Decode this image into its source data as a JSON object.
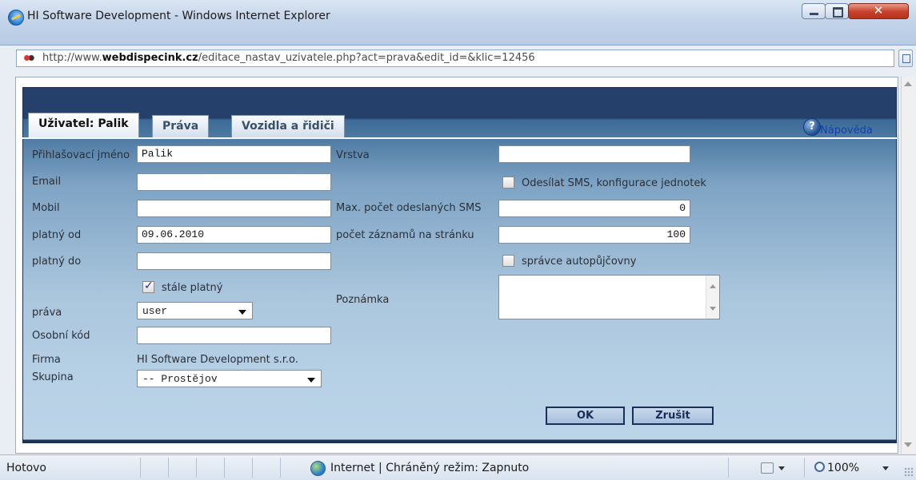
{
  "window": {
    "title": "HI Software Development - Windows Internet Explorer",
    "icon": "internet-explorer-icon"
  },
  "address": {
    "prefix": "http://www.",
    "domain": "webdispecink.cz",
    "path": "/editace_nastav_uzivatele.php?act=prava&edit_id=&klic=12456"
  },
  "tabs": [
    {
      "label": "Uživatel:  Palik",
      "active": true
    },
    {
      "label": "Práva",
      "active": false
    },
    {
      "label": "Vozidla a řidiči",
      "active": false
    }
  ],
  "help": {
    "label": "Nápověda",
    "icon": "help-icon"
  },
  "form": {
    "login_label": "Přihlašovací jméno",
    "login_value": "Palik",
    "email_label": "Email",
    "email_value": "",
    "mobile_label": "Mobil",
    "mobile_value": "",
    "valid_from_label": "platný od",
    "valid_from_value": "09.06.2010",
    "valid_to_label": "platný do",
    "valid_to_value": "",
    "always_valid_label": "stále platný",
    "always_valid_checked": true,
    "rights_label": "práva",
    "rights_value": "user",
    "personal_code_label": "Osobní kód",
    "personal_code_value": "",
    "company_label": "Firma",
    "company_value": "HI Software Development s.r.o.",
    "group_label": "Skupina",
    "group_value": "-- Prostějov",
    "layer_label": "Vrstva",
    "layer_value": "",
    "send_sms_label": "Odesílat SMS, konfigurace jednotek",
    "send_sms_checked": false,
    "max_sms_label": "Max. počet odeslaných SMS",
    "max_sms_value": "0",
    "records_label": "počet záznamů na stránku",
    "records_value": "100",
    "rental_admin_label": "správce autopůjčovny",
    "rental_admin_checked": false,
    "note_label": "Poznámka",
    "note_value": ""
  },
  "buttons": {
    "ok": "OK",
    "cancel": "Zrušit"
  },
  "status": {
    "text": "Hotovo",
    "zone": "Internet | Chráněný režim: Zapnuto",
    "zoom": "100%"
  },
  "colors": {
    "panel_top": "#25406a",
    "panel_bottom": "#bcd4e8",
    "button_border": "#1b2f57",
    "help_link": "#1242a8"
  }
}
